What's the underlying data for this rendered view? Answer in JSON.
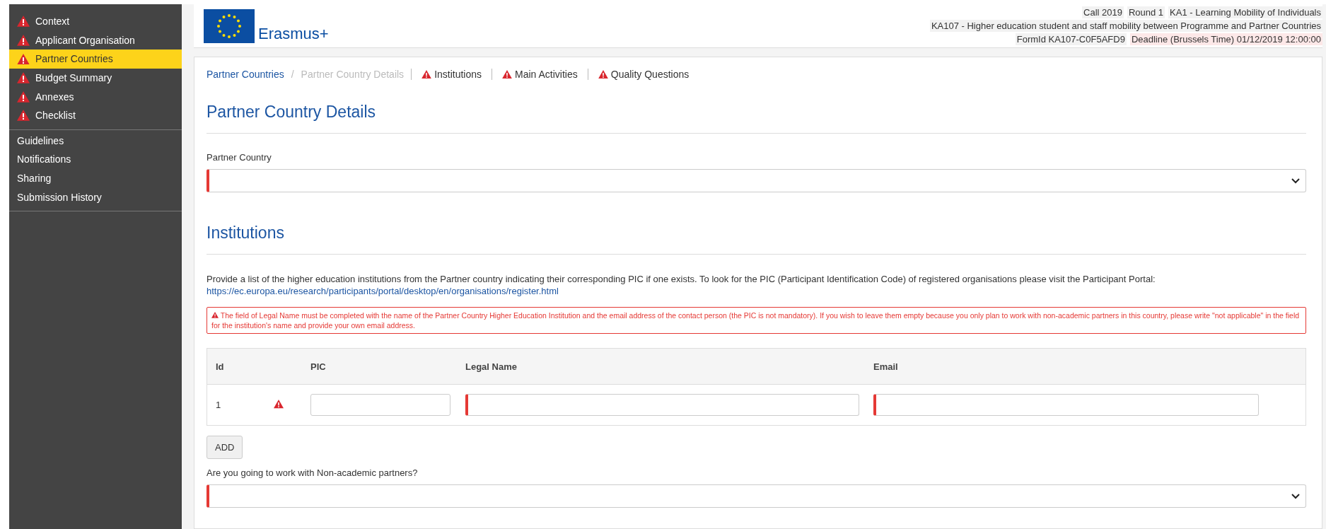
{
  "sidebar": {
    "sections": [
      {
        "items": [
          {
            "label": "Context",
            "warning": true,
            "selected": false
          },
          {
            "label": "Applicant Organisation",
            "warning": true,
            "selected": false
          },
          {
            "label": "Partner Countries",
            "warning": true,
            "selected": true
          },
          {
            "label": "Budget Summary",
            "warning": true,
            "selected": false
          },
          {
            "label": "Annexes",
            "warning": true,
            "selected": false
          },
          {
            "label": "Checklist",
            "warning": true,
            "selected": false
          }
        ]
      },
      {
        "items": [
          {
            "label": "Guidelines",
            "warning": false,
            "selected": false
          },
          {
            "label": "Notifications",
            "warning": false,
            "selected": false
          },
          {
            "label": "Sharing",
            "warning": false,
            "selected": false
          },
          {
            "label": "Submission History",
            "warning": false,
            "selected": false
          }
        ]
      }
    ]
  },
  "header": {
    "logo_text": "Erasmus+",
    "info_lines": [
      [
        {
          "text": "Call 2019",
          "kind": "tag"
        },
        {
          "text": "Round 1",
          "kind": "tag"
        },
        {
          "text": "KA1 - Learning Mobility of Individuals",
          "kind": "tag"
        }
      ],
      [
        {
          "text": "KA107 - Higher education student and staff mobility between Programme and Partner Countries",
          "kind": "tag"
        }
      ],
      [
        {
          "text": "FormId KA107-C0F5AFD9",
          "kind": "tag"
        },
        {
          "text": "Deadline (Brussels Time) 01/12/2019 12:00:00",
          "kind": "deadline"
        }
      ]
    ]
  },
  "breadcrumb": [
    {
      "label": "Partner Countries",
      "kind": "link"
    },
    {
      "label": "/",
      "kind": "separator"
    },
    {
      "label": "Partner Country Details",
      "kind": "current"
    }
  ],
  "tabs": [
    {
      "label": "Institutions",
      "warning": true
    },
    {
      "label": "Main Activities",
      "warning": true
    },
    {
      "label": "Quality Questions",
      "warning": true
    }
  ],
  "title": "Partner Country Details",
  "partner_country": {
    "label": "Partner Country",
    "required": true
  },
  "institutions": {
    "title": "Institutions",
    "intro": "Provide a list of the higher education institutions from the Partner country indicating their corresponding PIC if one exists. To look for the PIC (Participant Identification Code) of registered organisations please visit the Participant Portal:",
    "link": "https://ec.europa.eu/research/participants/portal/desktop/en/organisations/register.html",
    "alert": "The field of Legal Name must be completed with the name of the Partner Country Higher Education Institution and the email address of the contact person (the PIC is not mandatory). If you wish to leave them empty because you only plan to work with non-academic partners in this country, please write \"not applicable\" in the field for the institution's name and provide your own email address.",
    "table": {
      "columns": [
        "Id",
        "PIC",
        "Legal Name",
        "Email"
      ],
      "rows": [
        {
          "id": "1",
          "warning": true,
          "fields": [
            {
              "required": false
            },
            {
              "required": true
            },
            {
              "required": true
            }
          ]
        }
      ]
    },
    "add_button": "ADD"
  },
  "non_academic": {
    "label": "Are you going to work with Non-academic partners?",
    "required": true
  }
}
